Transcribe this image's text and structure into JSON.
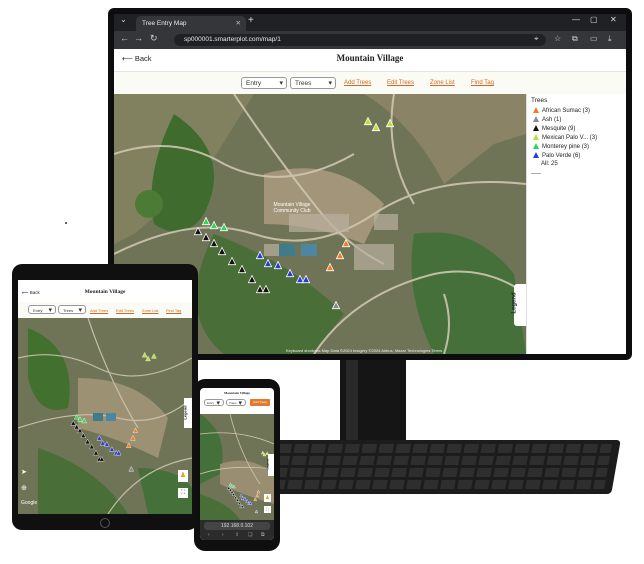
{
  "browser": {
    "tab_title": "Tree Entry Map",
    "tab_close": "✕",
    "new_tab": "+",
    "url": "sp000001.smarterplot.com/map/1",
    "window_controls": [
      "⌄",
      "—",
      "▢",
      "✕"
    ]
  },
  "app": {
    "back_label": "Back",
    "title": "Mountain Village",
    "toolbar": {
      "entry_select": "Entry",
      "trees_select": "Trees",
      "links": [
        "Add Trees",
        "Edit Trees",
        "Zone List",
        "Find Tag"
      ]
    }
  },
  "legend": {
    "title": "Trees",
    "items": [
      {
        "label": "African Sumac (3)",
        "color": "#f07c28"
      },
      {
        "label": "Ash (1)",
        "color": "#8a8a8a"
      },
      {
        "label": "Mesquite (9)",
        "color": "#111111"
      },
      {
        "label": "Mexican Palo V... (3)",
        "color": "#b7e03a"
      },
      {
        "label": "Monterey pine (3)",
        "color": "#2fd65a"
      },
      {
        "label": "Palo Verde (6)",
        "color": "#2b3bdb"
      }
    ],
    "total": "All: 25",
    "divider": "-----",
    "tab_label": "Legend"
  },
  "map": {
    "place_label": "Mountain Village Community Club",
    "footer": "Keyboard shortcuts    Map Data ©2024 Imagery ©2024 Airbus, Maxar Technologies    Terms"
  },
  "tablet": {
    "back_label": "Back",
    "title": "Mountain Village",
    "entry_select": "Entry",
    "trees_select": "Trees",
    "links": [
      "Add Trees",
      "Edit Trees",
      "Zone List",
      "Find Tag"
    ],
    "legend_tab": "Legend",
    "google": "Google"
  },
  "phone": {
    "title": "Mountain Village",
    "entry_select": "Entry",
    "trees_select": "Trees",
    "add_label": "Add Trees",
    "legend_tab": "Legend",
    "address": "192.168.0.102"
  }
}
